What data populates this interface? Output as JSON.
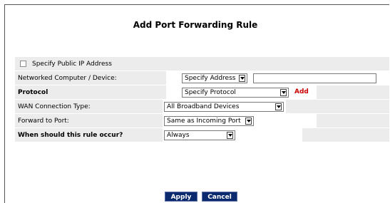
{
  "page": {
    "title": "Add Port Forwarding Rule"
  },
  "form": {
    "specify_public_ip": {
      "label": "Specify Public IP Address",
      "checked": false
    },
    "networked_computer": {
      "label": "Networked Computer / Device:",
      "select_value": "Specify Address",
      "input_value": ""
    },
    "protocol": {
      "label": "Protocol",
      "select_value": "Specify Protocol",
      "add_label": "Add"
    },
    "wan_connection_type": {
      "label": "WAN Connection Type:",
      "select_value": "All Broadband Devices"
    },
    "forward_to_port": {
      "label": "Forward to Port:",
      "select_value": "Same as Incoming Port"
    },
    "schedule": {
      "label": "When should this rule occur?",
      "select_value": "Always"
    }
  },
  "buttons": {
    "apply_label": "Apply",
    "cancel_label": "Cancel"
  },
  "colors": {
    "row_background": "#ececec",
    "button_background": "#0b2a6e",
    "add_link": "#cc0000"
  },
  "icons": {
    "dropdown": "chevron-down-icon"
  }
}
